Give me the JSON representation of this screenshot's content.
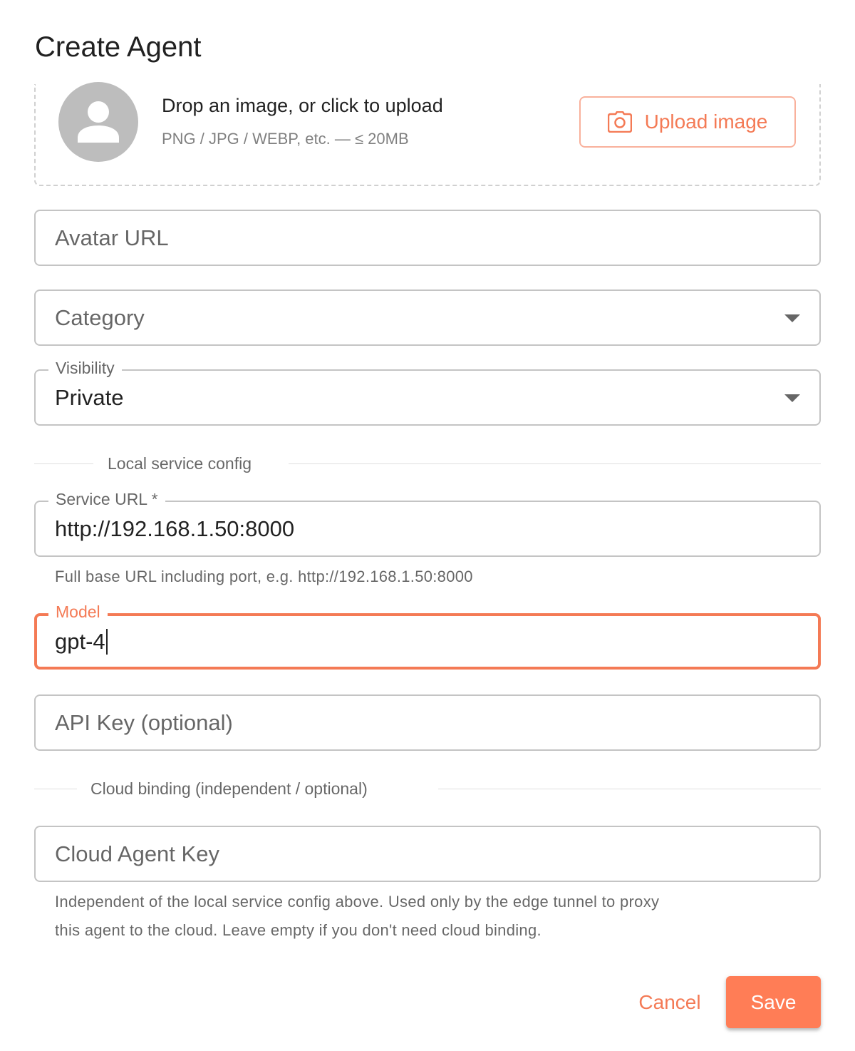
{
  "dialog": {
    "title": "Create Agent"
  },
  "upload": {
    "title": "Drop an image, or click to upload",
    "hint": "PNG / JPG / WEBP, etc. — ≤ 20MB",
    "button_label": "Upload image",
    "button_icon": "camera-icon"
  },
  "fields": {
    "avatar_url": {
      "placeholder": "Avatar URL",
      "value": ""
    },
    "category": {
      "placeholder": "Category",
      "value": ""
    },
    "visibility": {
      "label": "Visibility",
      "value": "Private"
    },
    "service_url": {
      "label": "Service URL *",
      "value": "http://192.168.1.50:8000",
      "helper": "Full base URL including port, e.g. http://192.168.1.50:8000"
    },
    "model": {
      "label": "Model",
      "value": "gpt-4"
    },
    "api_key": {
      "placeholder": "API Key (optional)",
      "value": ""
    },
    "cloud_agent_key": {
      "placeholder": "Cloud Agent Key",
      "value": "",
      "helper_line1": "Independent of the local service config above. Used only by the edge tunnel to proxy",
      "helper_line2": "this agent to the cloud. Leave empty if you don't need cloud binding."
    }
  },
  "sections": {
    "local": "Local service config",
    "cloud": "Cloud binding (independent / optional)"
  },
  "actions": {
    "cancel": "Cancel",
    "save": "Save"
  },
  "colors": {
    "accent": "#f47a55",
    "save_bg": "#ff7d56",
    "avatar_bg": "#bdbdbd"
  }
}
